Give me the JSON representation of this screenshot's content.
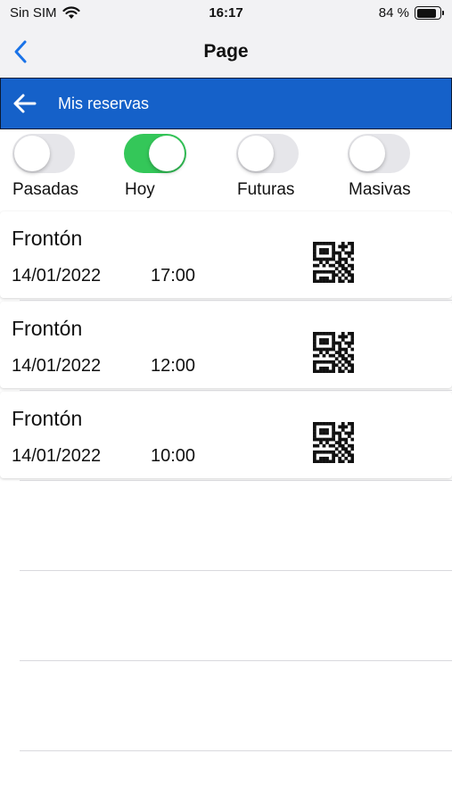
{
  "status_bar": {
    "carrier": "Sin SIM",
    "time": "16:17",
    "battery": "84 %",
    "battery_level": 0.84
  },
  "nav_bar": {
    "title": "Page"
  },
  "toolbar": {
    "title": "Mis reservas",
    "background": "#1561c9"
  },
  "filters": [
    {
      "label": "Pasadas",
      "on": false
    },
    {
      "label": "Hoy",
      "on": true
    },
    {
      "label": "Futuras",
      "on": false
    },
    {
      "label": "Masivas",
      "on": false
    }
  ],
  "reservations": [
    {
      "name": "Frontón",
      "date": "14/01/2022",
      "time": "17:00",
      "icon": "qr-code-icon"
    },
    {
      "name": "Frontón",
      "date": "14/01/2022",
      "time": "12:00",
      "icon": "qr-code-icon"
    },
    {
      "name": "Frontón",
      "date": "14/01/2022",
      "time": "10:00",
      "icon": "qr-code-icon"
    }
  ],
  "colors": {
    "accent": "#1561c9",
    "toggle_on": "#34c759",
    "ios_link": "#1a73e8"
  }
}
